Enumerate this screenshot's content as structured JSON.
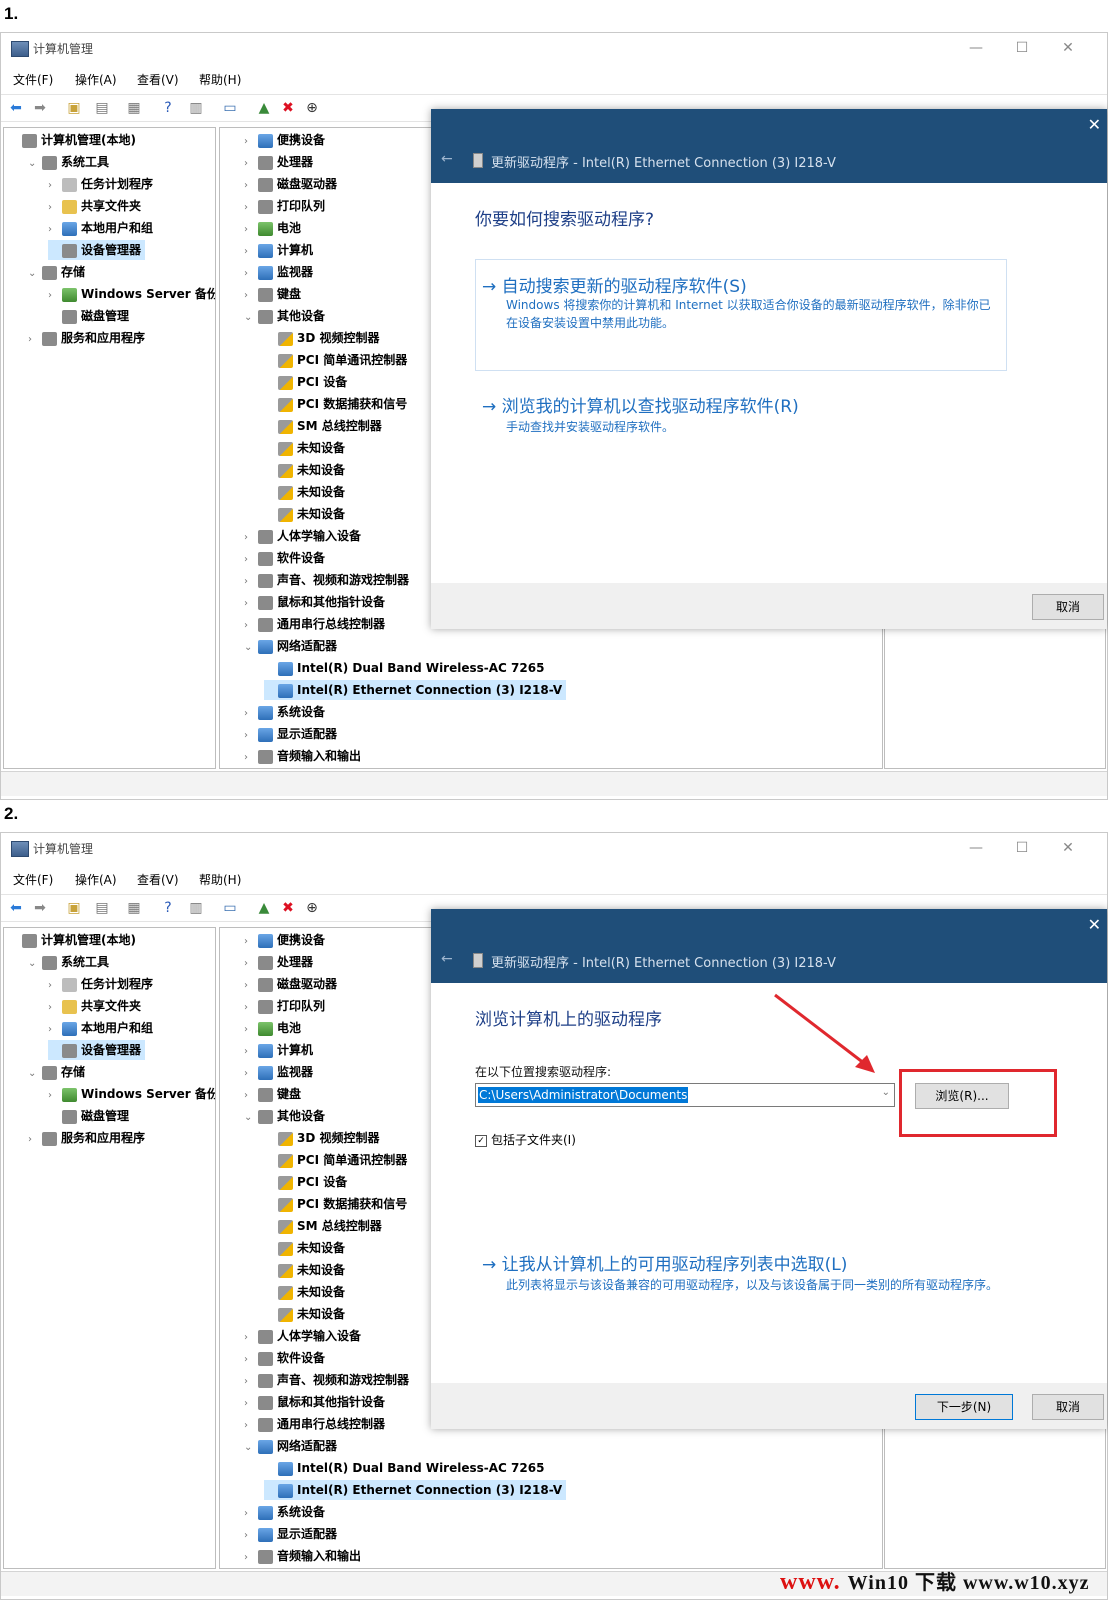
{
  "steps": [
    {
      "label": "1.",
      "window": {
        "title": "计算机管理",
        "menus": [
          "文件(F)",
          "操作(A)",
          "查看(V)",
          "帮助(H)"
        ],
        "left_tree": [
          {
            "label": "计算机管理(本地)",
            "chev": "",
            "icon": "gray"
          },
          {
            "label": "系统工具",
            "chev": "v",
            "icon": "gray"
          },
          {
            "label": "任务计划程序",
            "chev": ">",
            "icon": "clock"
          },
          {
            "label": "共享文件夹",
            "chev": ">",
            "icon": "folder"
          },
          {
            "label": "本地用户和组",
            "chev": ">",
            "icon": "blue"
          },
          {
            "label": "设备管理器",
            "chev": "",
            "icon": "gray",
            "selected": true
          },
          {
            "label": "存储",
            "chev": "v",
            "icon": "gray"
          },
          {
            "label": "Windows Server 备份",
            "chev": ">",
            "icon": "green"
          },
          {
            "label": "磁盘管理",
            "chev": "",
            "icon": "gray"
          },
          {
            "label": "服务和应用程序",
            "chev": ">",
            "icon": "gray"
          }
        ],
        "device_tree": [
          {
            "label": "便携设备",
            "chev": ">",
            "icon": "blue"
          },
          {
            "label": "处理器",
            "chev": ">",
            "icon": "gray"
          },
          {
            "label": "磁盘驱动器",
            "chev": ">",
            "icon": "gray"
          },
          {
            "label": "打印队列",
            "chev": ">",
            "icon": "gray"
          },
          {
            "label": "电池",
            "chev": ">",
            "icon": "green"
          },
          {
            "label": "计算机",
            "chev": ">",
            "icon": "blue"
          },
          {
            "label": "监视器",
            "chev": ">",
            "icon": "blue"
          },
          {
            "label": "键盘",
            "chev": ">",
            "icon": "gray"
          },
          {
            "label": "其他设备",
            "chev": "v",
            "icon": "gray"
          },
          {
            "label": "3D 视频控制器",
            "chev": "",
            "icon": "warn"
          },
          {
            "label": "PCI 简单通讯控制器",
            "chev": "",
            "icon": "warn"
          },
          {
            "label": "PCI 设备",
            "chev": "",
            "icon": "warn"
          },
          {
            "label": "PCI 数据捕获和信号",
            "chev": "",
            "icon": "warn"
          },
          {
            "label": "SM 总线控制器",
            "chev": "",
            "icon": "warn"
          },
          {
            "label": "未知设备",
            "chev": "",
            "icon": "warn"
          },
          {
            "label": "未知设备",
            "chev": "",
            "icon": "warn"
          },
          {
            "label": "未知设备",
            "chev": "",
            "icon": "warn"
          },
          {
            "label": "未知设备",
            "chev": "",
            "icon": "warn"
          },
          {
            "label": "人体学输入设备",
            "chev": ">",
            "icon": "gray"
          },
          {
            "label": "软件设备",
            "chev": ">",
            "icon": "gray"
          },
          {
            "label": "声音、视频和游戏控制器",
            "chev": ">",
            "icon": "gray"
          },
          {
            "label": "鼠标和其他指针设备",
            "chev": ">",
            "icon": "gray"
          },
          {
            "label": "通用串行总线控制器",
            "chev": ">",
            "icon": "gray"
          },
          {
            "label": "网络适配器",
            "chev": "v",
            "icon": "blue"
          },
          {
            "label": "Intel(R) Dual Band Wireless-AC 7265",
            "chev": "",
            "icon": "blue"
          },
          {
            "label": "Intel(R) Ethernet Connection (3) I218-V",
            "chev": "",
            "icon": "blue",
            "selected": true
          },
          {
            "label": "系统设备",
            "chev": ">",
            "icon": "blue"
          },
          {
            "label": "显示适配器",
            "chev": ">",
            "icon": "blue"
          },
          {
            "label": "音频输入和输出",
            "chev": ">",
            "icon": "gray"
          }
        ]
      },
      "dialog": {
        "title": "更新驱动程序 - Intel(R) Ethernet Connection (3) I218-V",
        "heading": "你要如何搜索驱动程序?",
        "option1_title": "→ 自动搜索更新的驱动程序软件(S)",
        "option1_desc": "Windows 将搜索你的计算机和 Internet 以获取适合你设备的最新驱动程序软件，除非你已在设备安装设置中禁用此功能。",
        "option2_title": "→ 浏览我的计算机以查找驱动程序软件(R)",
        "option2_desc": "手动查找并安装驱动程序软件。",
        "cancel": "取消"
      }
    },
    {
      "label": "2.",
      "dialog": {
        "title": "更新驱动程序 - Intel(R) Ethernet Connection (3) I218-V",
        "heading": "浏览计算机上的驱动程序",
        "search_label": "在以下位置搜索驱动程序:",
        "path": "C:\\Users\\Administrator\\Documents",
        "browse": "浏览(R)...",
        "include_subfolders": "包括子文件夹(I)",
        "option_title": "→ 让我从计算机上的可用驱动程序列表中选取(L)",
        "option_desc": "此列表将显示与该设备兼容的可用驱动程序，以及与该设备属于同一类别的所有驱动程序序。",
        "next": "下一步(N)",
        "cancel": "取消"
      }
    }
  ],
  "watermark": {
    "red": "www.",
    "dark": "Win10 下载 www.w10.xyz"
  },
  "colors": {
    "dialog_header": "#1f4e79",
    "link_blue": "#1f6fc0",
    "highlight": "#e0282e"
  }
}
